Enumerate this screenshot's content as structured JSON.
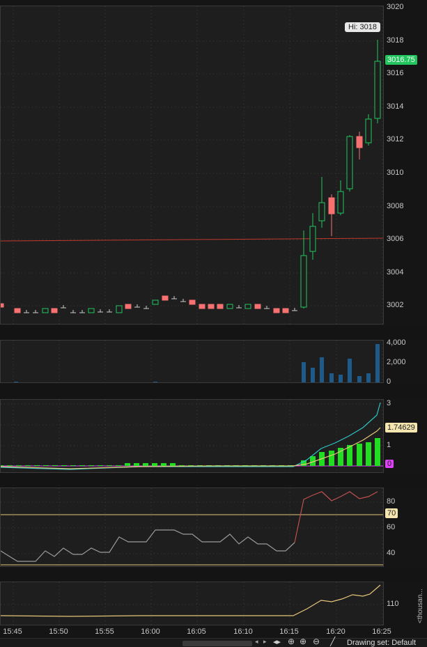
{
  "price": {
    "ticks": [
      "3020",
      "3018",
      "3016",
      "3014",
      "3012",
      "3010",
      "3008",
      "3006",
      "3004",
      "3002"
    ],
    "hi_label": "Hi: 3018",
    "last_label": "3016.75",
    "last_color": "#22c55e"
  },
  "volume": {
    "ticks": [
      "4,000",
      "2,000",
      "0"
    ]
  },
  "macd": {
    "ticks": [
      "3",
      "1"
    ],
    "value_label": "1.74629",
    "zero_label": "0"
  },
  "rsi": {
    "ticks": [
      "80",
      "60",
      "40"
    ],
    "level_label": "70"
  },
  "lower": {
    "ticks": [
      "110"
    ],
    "side_label": "<thousan..."
  },
  "time_axis": {
    "labels": [
      "15:45",
      "15:50",
      "15:55",
      "16:00",
      "16:05",
      "16:10",
      "16:15",
      "16:20",
      "16:25"
    ]
  },
  "toolbar": {
    "drawing_set": "Drawing set: Default"
  },
  "colors": {
    "up": "#22c55e",
    "down": "#f87171",
    "vol": "#1e5a8a",
    "macd_hist": "#22dd22",
    "rsi_line": "#c05050",
    "level_line": "#e6c77a",
    "macd_line": "#2ec4c4",
    "signal_line": "#e6c77a",
    "ref_line": "#c0392b"
  }
}
